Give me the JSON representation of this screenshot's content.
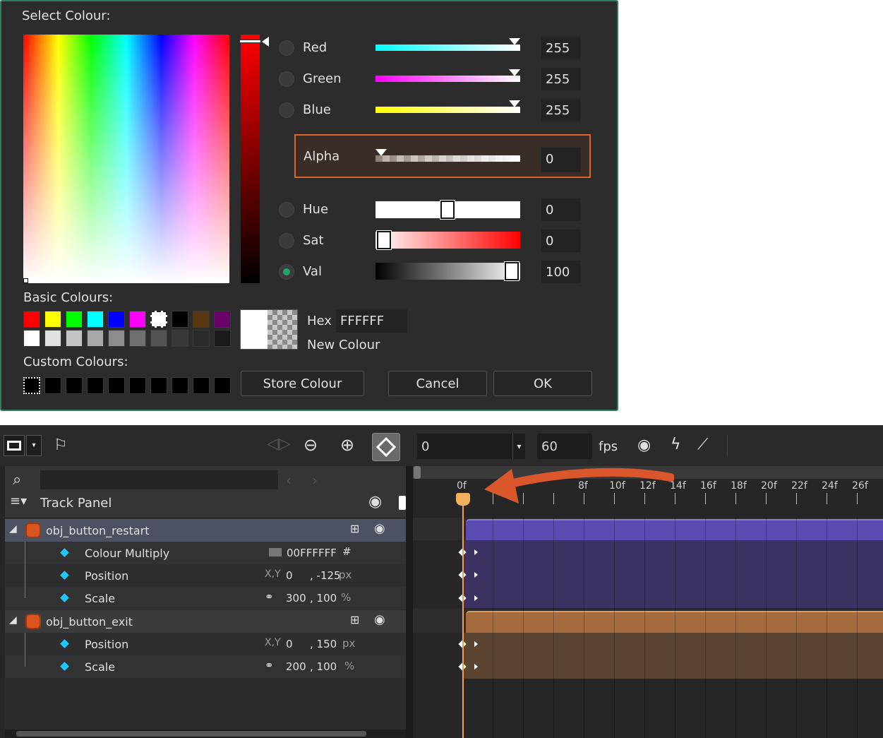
{
  "dialog": {
    "title": "Select Colour:",
    "rows": [
      {
        "label": "Red",
        "value": "255",
        "selected": false
      },
      {
        "label": "Green",
        "value": "255",
        "selected": false
      },
      {
        "label": "Blue",
        "value": "255",
        "selected": false
      }
    ],
    "alpha": {
      "label": "Alpha",
      "value": "0"
    },
    "hsv": [
      {
        "label": "Hue",
        "value": "0",
        "selected": false
      },
      {
        "label": "Sat",
        "value": "0",
        "selected": false
      },
      {
        "label": "Val",
        "value": "100",
        "selected": true
      }
    ],
    "basic_colours_label": "Basic Colours:",
    "basic_colours_row1": [
      "#ff0000",
      "#ffff00",
      "#00ff00",
      "#00ffff",
      "#0000ff",
      "#ff00ff",
      "#ffffff",
      "#000000",
      "#5a3610",
      "#6a006a"
    ],
    "basic_colours_row2": [
      "#ffffff",
      "#e0e0e0",
      "#c4c4c4",
      "#a8a8a8",
      "#8c8c8c",
      "#707070",
      "#545454",
      "#383838",
      "#2a2a2a",
      "#1a1a1a"
    ],
    "custom_colours_label": "Custom Colours:",
    "hex_label": "Hex",
    "hex_value": "FFFFFF",
    "new_colour_label": "New Colour",
    "buttons": {
      "store": "Store Colour",
      "cancel": "Cancel",
      "ok": "OK"
    }
  },
  "toolbar": {
    "frame_value": "0",
    "fps_value": "60",
    "fps_label": "fps"
  },
  "track_panel": {
    "title": "Track Panel",
    "search_placeholder": "",
    "tracks": [
      {
        "name": "obj_button_restart",
        "properties": [
          {
            "name": "Colour Multiply",
            "prefix": "",
            "values": [
              "00FFFFFF"
            ],
            "unit": "#"
          },
          {
            "name": "Position",
            "prefix": "X,Y",
            "values": [
              "0",
              ", -125"
            ],
            "unit": "px"
          },
          {
            "name": "Scale",
            "prefix": "link",
            "values": [
              "300",
              ", 100"
            ],
            "unit": "%"
          }
        ]
      },
      {
        "name": "obj_button_exit",
        "properties": [
          {
            "name": "Position",
            "prefix": "X,Y",
            "values": [
              "0",
              ", 150"
            ],
            "unit": "px"
          },
          {
            "name": "Scale",
            "prefix": "link",
            "values": [
              "200",
              ", 100"
            ],
            "unit": "%"
          }
        ]
      }
    ]
  },
  "timeline": {
    "tick_labels": [
      "0f",
      "8f",
      "10f",
      "12f",
      "14f",
      "16f",
      "18f",
      "20f",
      "22f",
      "24f",
      "26f"
    ],
    "track_colors": {
      "restart": "#4a3a84",
      "exit": "#a76b3b"
    }
  }
}
